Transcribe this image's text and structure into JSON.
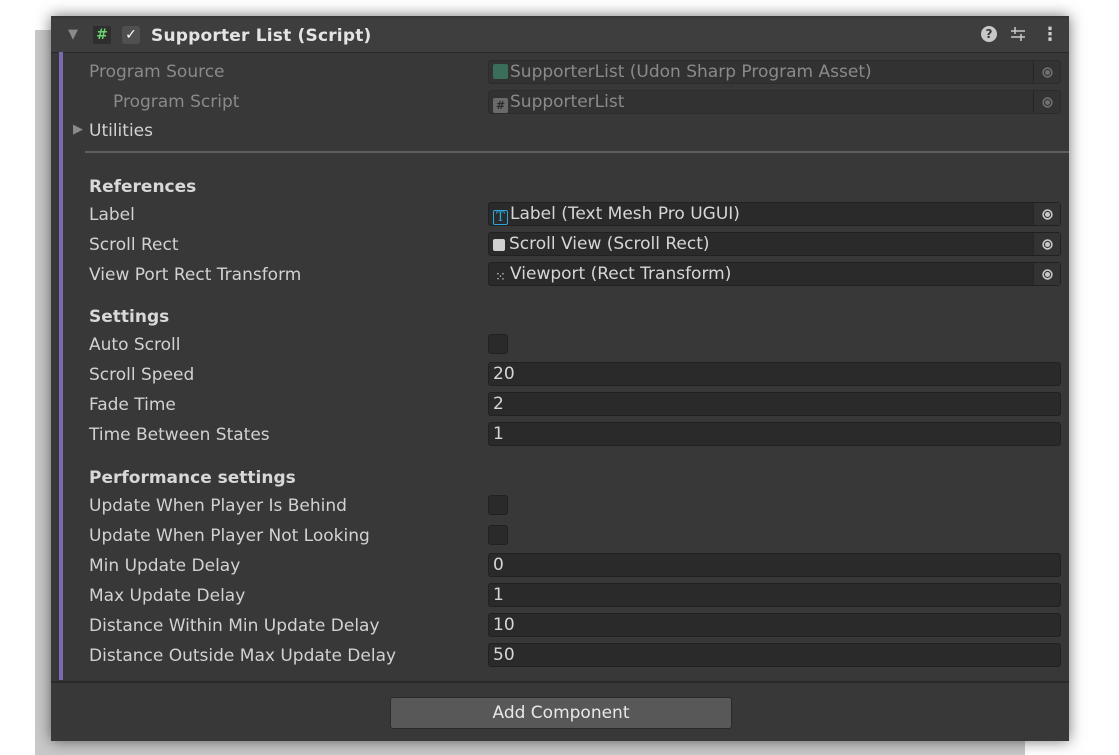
{
  "component": {
    "title": "Supporter List (Script)",
    "enabled": true,
    "icons": {
      "fold": "triangle-down-icon",
      "script": "script-icon",
      "help": "help-icon",
      "presets": "presets-icon",
      "menu": "kebab-menu-icon"
    }
  },
  "program": {
    "source_label": "Program Source",
    "source_value": "SupporterList (Udon Sharp Program Asset)",
    "script_label": "Program Script",
    "script_value": "SupporterList",
    "utilities_label": "Utilities"
  },
  "references": {
    "title": "References",
    "rows": [
      {
        "label": "Label",
        "value": "Label (Text Mesh Pro UGUI)",
        "icon": "text-mesh-pro-icon"
      },
      {
        "label": "Scroll Rect",
        "value": "Scroll View (Scroll Rect)",
        "icon": "scroll-rect-icon"
      },
      {
        "label": "View Port Rect Transform",
        "value": "Viewport (Rect Transform)",
        "icon": "rect-transform-icon"
      }
    ]
  },
  "settings": {
    "title": "Settings",
    "auto_scroll_label": "Auto Scroll",
    "auto_scroll": false,
    "scroll_speed_label": "Scroll Speed",
    "scroll_speed": "20",
    "fade_time_label": "Fade Time",
    "fade_time": "2",
    "time_between_states_label": "Time Between States",
    "time_between_states": "1"
  },
  "performance": {
    "title": "Performance settings",
    "behind_label": "Update When Player Is Behind",
    "behind": false,
    "not_looking_label": "Update When Player Not Looking",
    "not_looking": false,
    "min_delay_label": "Min Update Delay",
    "min_delay": "0",
    "max_delay_label": "Max Update Delay",
    "max_delay": "1",
    "dist_min_label": "Distance Within Min Update Delay",
    "dist_min": "10",
    "dist_max_label": "Distance Outside Max Update Delay",
    "dist_max": "50"
  },
  "footer": {
    "add_component": "Add Component"
  },
  "colors": {
    "accent": "#7c6ab0",
    "panel": "#383838",
    "field": "#2a2a2a",
    "script_icon": "#6cd36c",
    "tmp_icon": "#29a8e0"
  }
}
